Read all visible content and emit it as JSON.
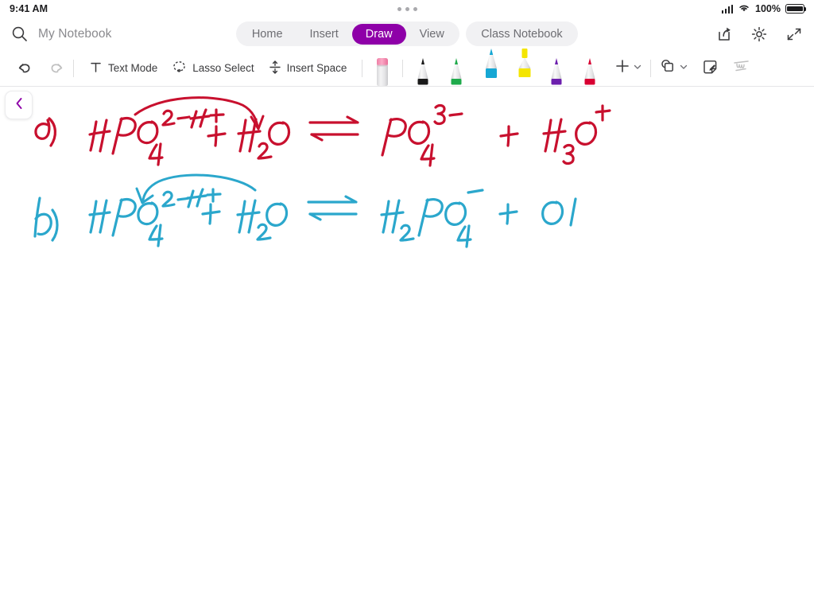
{
  "status_bar": {
    "time": "9:41 AM",
    "battery_percent": "100%",
    "wifi_icon": "wifi-icon",
    "cellular_icon": "cellular-signal-icon",
    "battery_icon": "battery-full-icon",
    "multitask_handle_icon": "multitask-dots-icon"
  },
  "nav": {
    "search_icon": "search-icon",
    "notebook_title": "My Notebook",
    "tabs": [
      {
        "label": "Home",
        "active": false
      },
      {
        "label": "Insert",
        "active": false
      },
      {
        "label": "Draw",
        "active": true
      },
      {
        "label": "View",
        "active": false
      }
    ],
    "class_notebook_tab": "Class Notebook",
    "active_tab_color": "#8e00a8",
    "share_icon": "share-icon",
    "settings_icon": "gear-icon",
    "collapse_icon": "collapse-ribbon-icon"
  },
  "toolbar": {
    "undo_icon": "undo-icon",
    "redo_icon": "redo-icon",
    "redo_disabled": true,
    "text_mode": {
      "label": "Text Mode",
      "icon": "text-mode-icon"
    },
    "lasso_select": {
      "label": "Lasso Select",
      "icon": "lasso-select-icon"
    },
    "insert_space": {
      "label": "Insert Space",
      "icon": "insert-space-icon"
    },
    "eraser": {
      "name": "eraser",
      "color": "#f28ab0"
    },
    "pens": [
      {
        "name": "black-pen",
        "color": "#1a1a1a",
        "type": "pen",
        "selected": false
      },
      {
        "name": "green-pen",
        "color": "#1faa4b",
        "type": "pen",
        "selected": false
      },
      {
        "name": "cyan-pen",
        "color": "#16a7d4",
        "type": "pen",
        "selected": true
      },
      {
        "name": "yellow-highlighter",
        "color": "#f4e500",
        "type": "highlighter",
        "selected": true
      },
      {
        "name": "purple-pen",
        "color": "#6c1fad",
        "type": "pen",
        "selected": false
      },
      {
        "name": "red-pen",
        "color": "#d80032",
        "type": "pen",
        "selected": false
      }
    ],
    "add_pen": {
      "icon": "plus-icon",
      "chevron": "chevron-down-icon"
    },
    "shapes": {
      "icon": "shapes-icon",
      "chevron": "chevron-down-icon"
    },
    "sticky_note": {
      "icon": "note-with-pencil-icon"
    },
    "ink_to_shape": {
      "icon": "ink-scribble-icon",
      "disabled": true
    }
  },
  "canvas": {
    "back_button_icon": "chevron-left-icon",
    "back_button_color": "#8e00a8",
    "ink_colors": {
      "red": "#c8102e",
      "cyan": "#2ba7cc"
    },
    "notes": [
      {
        "label": "a)",
        "color": "red",
        "equation": "HPO4^2-  +  H2O  ⇌  PO4^3-  +  H3O^+",
        "annotation": "H+",
        "annotation_direction": "forward-proton-transfer",
        "reactants": [
          "HPO4^2-",
          "H2O"
        ],
        "products": [
          "PO4^3-",
          "H3O^+"
        ]
      },
      {
        "label": "b)",
        "color": "cyan",
        "equation": "HPO4^2-  +  H2O  ⇌  H2PO4^-  +  O|",
        "annotation": "H+",
        "annotation_direction": "reverse-proton-transfer",
        "reactants": [
          "HPO4^2-",
          "H2O"
        ],
        "products": [
          "H2PO4^-",
          "O|"
        ]
      }
    ]
  }
}
